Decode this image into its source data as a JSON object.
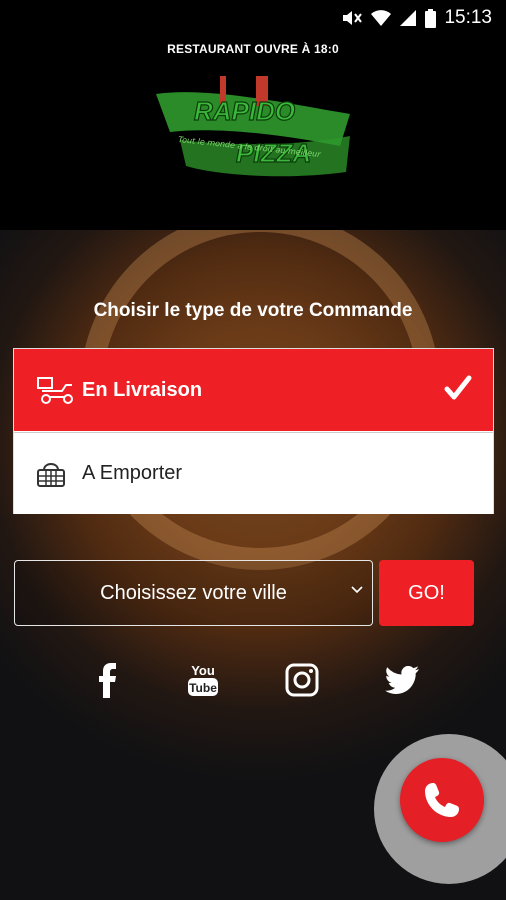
{
  "status_bar": {
    "time": "15:13"
  },
  "header": {
    "open_info": "RESTAURANT OUVRE À 18:0",
    "logo": {
      "line1": "RAPIDO",
      "line2": "PIZZA",
      "slogan": "Tout le monde a le droit au meilleur"
    }
  },
  "main": {
    "title": "Choisir le type de votre Commande",
    "options": [
      {
        "label": "En Livraison",
        "selected": true,
        "icon": "delivery-scooter-icon"
      },
      {
        "label": "A Emporter",
        "selected": false,
        "icon": "basket-icon"
      }
    ],
    "city_placeholder": "Choisissez votre ville",
    "go_label": "GO!",
    "social": [
      "facebook",
      "youtube",
      "instagram",
      "twitter"
    ]
  },
  "colors": {
    "accent": "#ee1f25",
    "logo_green": "#3cb83a",
    "background": "#000000"
  }
}
